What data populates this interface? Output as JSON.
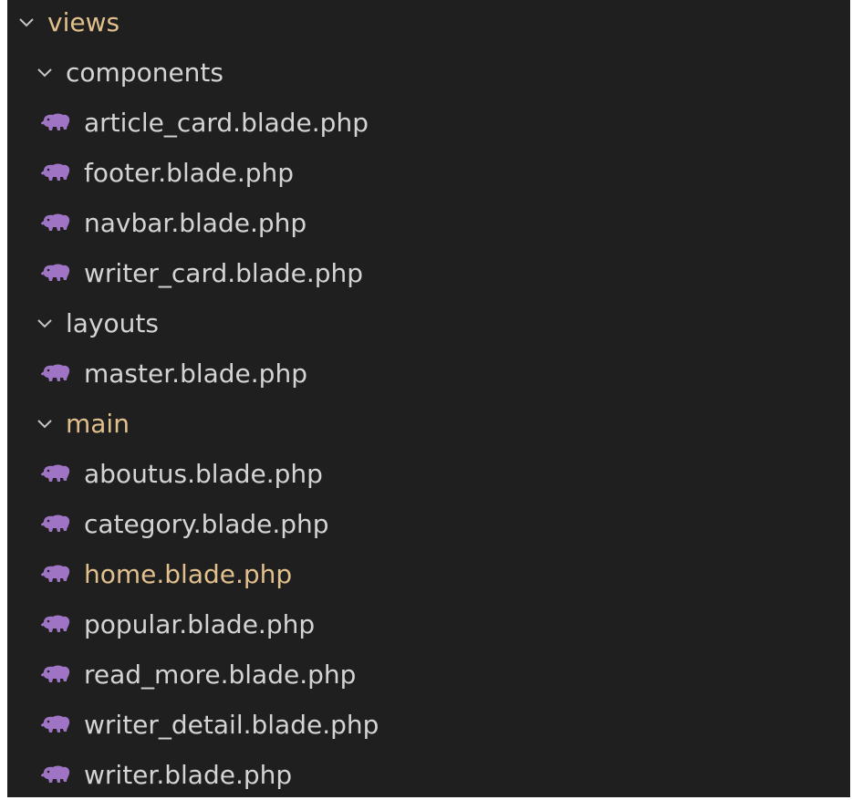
{
  "colors": {
    "background": "#1f1f1f",
    "text": "#d4d4d4",
    "modified_text": "#e2c08d",
    "php_icon": "#a074c4"
  },
  "tree": {
    "root": {
      "label": "views",
      "icon": "chevron-down-icon"
    },
    "components": {
      "label": "components",
      "icon": "chevron-down-icon",
      "files": [
        {
          "label": "article_card.blade.php",
          "icon": "php-elephant-icon"
        },
        {
          "label": "footer.blade.php",
          "icon": "php-elephant-icon"
        },
        {
          "label": "navbar.blade.php",
          "icon": "php-elephant-icon"
        },
        {
          "label": "writer_card.blade.php",
          "icon": "php-elephant-icon"
        }
      ]
    },
    "layouts": {
      "label": "layouts",
      "icon": "chevron-down-icon",
      "files": [
        {
          "label": "master.blade.php",
          "icon": "php-elephant-icon"
        }
      ]
    },
    "main": {
      "label": "main",
      "icon": "chevron-down-icon",
      "files": [
        {
          "label": "aboutus.blade.php",
          "icon": "php-elephant-icon"
        },
        {
          "label": "category.blade.php",
          "icon": "php-elephant-icon"
        },
        {
          "label": "home.blade.php",
          "icon": "php-elephant-icon"
        },
        {
          "label": "popular.blade.php",
          "icon": "php-elephant-icon"
        },
        {
          "label": "read_more.blade.php",
          "icon": "php-elephant-icon"
        },
        {
          "label": "writer_detail.blade.php",
          "icon": "php-elephant-icon"
        },
        {
          "label": "writer.blade.php",
          "icon": "php-elephant-icon"
        }
      ]
    }
  }
}
